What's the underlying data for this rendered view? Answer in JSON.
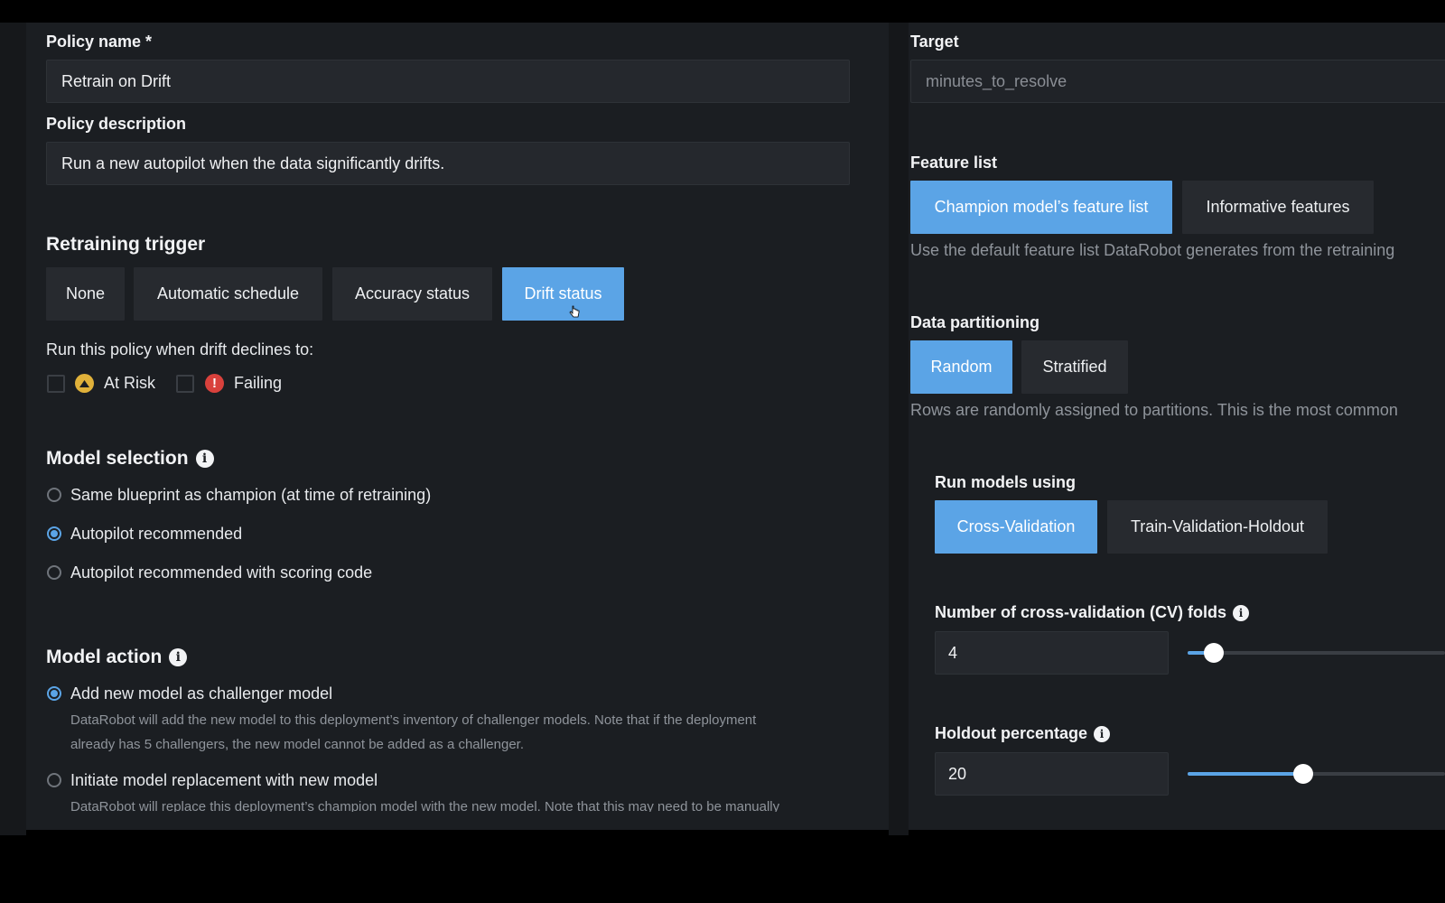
{
  "left": {
    "policy_name": {
      "label": "Policy name *",
      "value": "Retrain on Drift"
    },
    "policy_description": {
      "label": "Policy description",
      "value": "Run a new autopilot when the data significantly drifts."
    },
    "retraining_trigger": {
      "title": "Retraining trigger",
      "options": [
        "None",
        "Automatic schedule",
        "Accuracy status",
        "Drift status"
      ],
      "selected": "Drift status",
      "condition_label": "Run this policy when drift declines to:",
      "at_risk_label": "At Risk",
      "failing_label": "Failing"
    },
    "model_selection": {
      "title": "Model selection",
      "options": [
        "Same blueprint as champion (at time of retraining)",
        "Autopilot recommended",
        "Autopilot recommended with scoring code"
      ],
      "selected": "Autopilot recommended"
    },
    "model_action": {
      "title": "Model action",
      "option1": "Add new model as challenger model",
      "option1_desc_line1": "DataRobot will add the new model to this deployment’s inventory of challenger models. Note that if the deployment",
      "option1_desc_line2": "already has 5 challengers, the new model cannot be added as a challenger.",
      "option2": "Initiate model replacement with new model",
      "option2_desc": "DataRobot will replace this deployment’s champion model with the new model. Note that this may need to be manually",
      "selected": "Add new model as challenger model"
    }
  },
  "right": {
    "target": {
      "label": "Target",
      "value": "minutes_to_resolve"
    },
    "feature_list": {
      "label": "Feature list",
      "options": [
        "Champion model’s feature list",
        "Informative features"
      ],
      "selected": "Champion model’s feature list",
      "help": "Use the default feature list DataRobot generates from the retraining"
    },
    "data_partitioning": {
      "label": "Data partitioning",
      "options": [
        "Random",
        "Stratified"
      ],
      "selected": "Random",
      "help": "Rows are randomly assigned to partitions. This is the most common"
    },
    "run_models_using": {
      "label": "Run models using",
      "options": [
        "Cross-Validation",
        "Train-Validation-Holdout"
      ],
      "selected": "Cross-Validation"
    },
    "cv_folds": {
      "label": "Number of cross-validation (CV) folds",
      "value": "4",
      "slider_fraction": 0.1
    },
    "holdout": {
      "label": "Holdout percentage",
      "value": "20",
      "slider_fraction": 0.45
    }
  },
  "colors": {
    "accent": "#5ba4e6",
    "at_risk": "#e0b13a",
    "failing": "#d9413c",
    "panel": "#1b1e22"
  }
}
